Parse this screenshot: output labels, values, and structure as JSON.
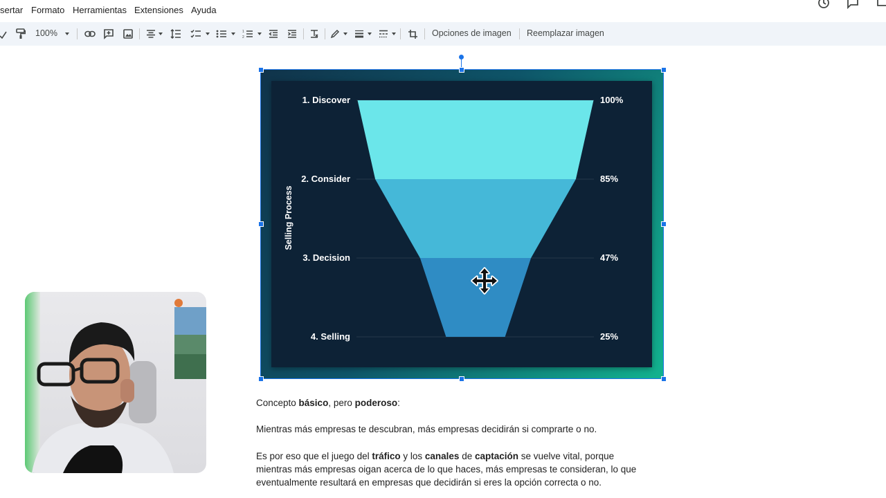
{
  "menu": {
    "insert_partial": "sertar",
    "format": "Formato",
    "tools": "Herramientas",
    "extensions": "Extensiones",
    "help": "Ayuda"
  },
  "toolbar": {
    "zoom": "100%",
    "image_options": "Opciones de imagen",
    "replace_image": "Reemplazar imagen"
  },
  "icons": {
    "history": "history-icon",
    "comments": "comment-icon",
    "move_cursor": "move-cursor-icon"
  },
  "colors": {
    "selection": "#1a73e8",
    "toolbar_bg": "#f0f4f9",
    "funnel_bg": "#0d2236",
    "funnel_stage_1": "#6be6ea",
    "funnel_stage_2": "#45b8d8",
    "funnel_stage_3": "#2f8cc4"
  },
  "chart_data": {
    "type": "funnel",
    "ylabel": "Selling Process",
    "categories": [
      "1. Discover",
      "2. Consider",
      "3. Decision",
      "4. Selling"
    ],
    "values": [
      100,
      85,
      47,
      25
    ],
    "value_labels": [
      "100%",
      "85%",
      "47%",
      "25%"
    ],
    "unit": "%"
  },
  "document": {
    "line1_a": "Concepto ",
    "line1_b": "básico",
    "line1_c": ", pero ",
    "line1_d": "poderoso",
    "line1_e": ":",
    "para2": "Mientras más empresas te descubran, más empresas decidirán si comprarte o no.",
    "para3_a": "Es por eso que el juego del ",
    "para3_b": "tráfico",
    "para3_c": " y los ",
    "para3_d": "canales",
    "para3_e": " de ",
    "para3_f": "captación",
    "para3_g": " se vuelve vital, porque",
    "para3_line2": "mientras más empresas oigan acerca de lo que haces, más empresas te consideran, lo que",
    "para3_line3": "eventualmente resultará en empresas que decidirán si eres la opción correcta o no."
  }
}
